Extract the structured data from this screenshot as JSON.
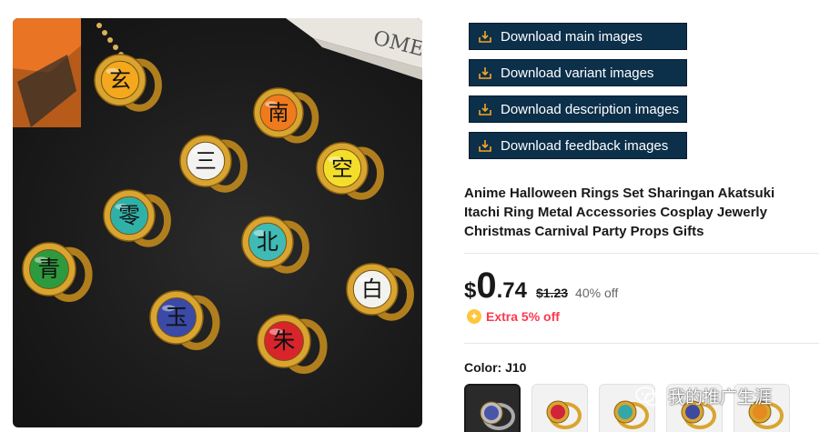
{
  "downloads": [
    {
      "label": "Download main images"
    },
    {
      "label": "Download variant images"
    },
    {
      "label": "Download description images"
    },
    {
      "label": "Download feedback images"
    }
  ],
  "product": {
    "title": "Anime Halloween Rings Set Sharingan Akatsuki Itachi Ring Metal Accessories Cosplay Jewerly Christmas Carnival Party Props Gifts",
    "price": {
      "currency": "$",
      "integer": "0",
      "decimal": ".74",
      "original": "$1.23",
      "discount": "40% off"
    },
    "extra_discount": "Extra 5% off",
    "color_label": "Color: J10",
    "variants": [
      {
        "stone": "#4a55a8",
        "selected": true
      },
      {
        "stone": "#d1243a",
        "selected": false
      },
      {
        "stone": "#34a7a8",
        "selected": false
      },
      {
        "stone": "#3d4aa0",
        "selected": false
      },
      {
        "stone": "#e58a1f",
        "selected": false
      }
    ]
  },
  "photo_rings": [
    {
      "char": "玄",
      "color": "#f4a81d"
    },
    {
      "char": "南",
      "color": "#f07a1e"
    },
    {
      "char": "三",
      "color": "#f2f2f0"
    },
    {
      "char": "空",
      "color": "#f3df2b"
    },
    {
      "char": "零",
      "color": "#2fb1a8"
    },
    {
      "char": "北",
      "color": "#3fbab5"
    },
    {
      "char": "青",
      "color": "#2e9a3e"
    },
    {
      "char": "白",
      "color": "#f2f2ef"
    },
    {
      "char": "玉",
      "color": "#3a4aa6"
    },
    {
      "char": "朱",
      "color": "#d8252c"
    }
  ],
  "photo_box_text": "OMER",
  "watermark": "我的推广生涯",
  "colors": {
    "button_bg": "#0c2f4a",
    "gold": "#d9a530",
    "extra_red": "#fd384f",
    "coin": "#ffc53d"
  }
}
